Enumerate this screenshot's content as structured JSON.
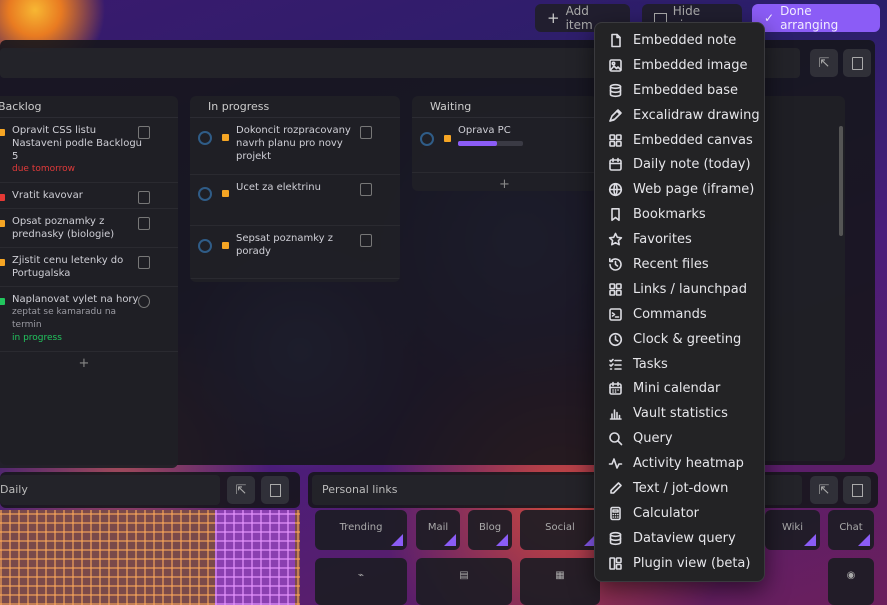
{
  "toolbar": {
    "add_label": "Add item",
    "hide_label": "Hide view",
    "done_label": "Done arranging"
  },
  "kanban": {
    "columns": [
      {
        "title": "Backlog",
        "cards": [
          {
            "text": "Opravit CSS listu Nastaveni podle Backlogu 5",
            "sub": "due tomorrow",
            "color": "#f5a524",
            "subcolor": "#e03a3a"
          },
          {
            "text": "Vratit kavovar",
            "sub": "",
            "color": "#e53935",
            "subcolor": ""
          },
          {
            "text": "Opsat poznamky z prednasky (biologie)",
            "sub": "",
            "color": "#f5a524",
            "subcolor": ""
          },
          {
            "text": "Zjistit cenu letenky do Portugalska",
            "sub": "",
            "color": "#f5a524",
            "subcolor": ""
          },
          {
            "text": "Naplanovat vylet na hory",
            "sub": "zeptat se kamaradu na termin",
            "color": "#22c55e",
            "subcolor": "#9a9aa2",
            "sub2": "in progress",
            "sub2color": "#22c55e"
          }
        ]
      },
      {
        "title": "In progress",
        "cards": [
          {
            "text": "Dokoncit rozpracovany navrh planu pro novy projekt",
            "sub": ""
          },
          {
            "text": "Ucet za elektrinu",
            "sub": ""
          },
          {
            "text": "Sepsat poznamky z porady",
            "sub": ""
          }
        ]
      },
      {
        "title": "Waiting",
        "cards": [
          {
            "text": "Oprava PC",
            "sub": "",
            "progress": 0.6
          }
        ]
      }
    ]
  },
  "bottom": {
    "left_title": "Daily",
    "right_title": "Personal links",
    "tiles": [
      "Trending",
      "Mail",
      "Blog",
      "Social",
      "Wiki",
      "Chat"
    ]
  },
  "menu": {
    "items": [
      {
        "label": "Embedded note",
        "icon": "file-icon"
      },
      {
        "label": "Embedded image",
        "icon": "image-icon"
      },
      {
        "label": "Embedded base",
        "icon": "database-icon"
      },
      {
        "label": "Excalidraw drawing",
        "icon": "pen-tool-icon"
      },
      {
        "label": "Embedded canvas",
        "icon": "layout-grid-icon"
      },
      {
        "label": "Daily note (today)",
        "icon": "calendar-icon"
      },
      {
        "label": "Web page (iframe)",
        "icon": "globe-icon"
      },
      {
        "label": "Bookmarks",
        "icon": "bookmark-icon"
      },
      {
        "label": "Favorites",
        "icon": "star-icon"
      },
      {
        "label": "Recent files",
        "icon": "history-icon"
      },
      {
        "label": "Links / launchpad",
        "icon": "grid-icon"
      },
      {
        "label": "Commands",
        "icon": "terminal-icon"
      },
      {
        "label": "Clock & greeting",
        "icon": "clock-icon"
      },
      {
        "label": "Tasks",
        "icon": "list-checks-icon"
      },
      {
        "label": "Mini calendar",
        "icon": "calendar-days-icon"
      },
      {
        "label": "Vault statistics",
        "icon": "bar-chart-icon"
      },
      {
        "label": "Query",
        "icon": "search-icon"
      },
      {
        "label": "Activity heatmap",
        "icon": "activity-icon"
      },
      {
        "label": "Text / jot-down",
        "icon": "pencil-icon"
      },
      {
        "label": "Calculator",
        "icon": "calculator-icon"
      },
      {
        "label": "Dataview query",
        "icon": "database-icon"
      },
      {
        "label": "Plugin view (beta)",
        "icon": "panels-icon"
      }
    ]
  }
}
